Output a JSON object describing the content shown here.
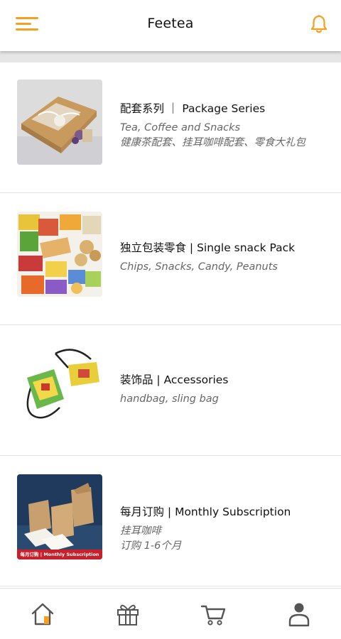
{
  "header": {
    "title": "Feetea",
    "menu_icon": "hamburger-menu-icon",
    "bell_icon": "bell-icon",
    "accent_color": "#f5a020"
  },
  "categories": [
    {
      "title": "配套系列 ｜ Package Series",
      "subtitle_lines": [
        "Tea, Coffee and Snacks",
        "健康茶配套、挂耳咖啡配套、零食大礼包"
      ],
      "image": "gift-package-photo"
    },
    {
      "title": "独立包装零食 | Single snack Pack",
      "subtitle_lines": [
        "Chips, Snacks, Candy, Peanuts"
      ],
      "image": "snack-packs-photo"
    },
    {
      "title": "装饰品 | Accessories",
      "subtitle_lines": [
        "handbag, sling bag"
      ],
      "image": "sling-bag-photo"
    },
    {
      "title": "每月订购 | Monthly Subscription",
      "subtitle_lines": [
        "挂耳咖啡",
        "订购 1-6个月"
      ],
      "image": "subscription-photo",
      "image_banner": "每月订购 | Monthly Subscription"
    }
  ],
  "bottom_nav": [
    {
      "name": "home",
      "icon": "home-icon",
      "active": true
    },
    {
      "name": "gift",
      "icon": "gift-icon",
      "active": false
    },
    {
      "name": "cart",
      "icon": "cart-icon",
      "active": false
    },
    {
      "name": "profile",
      "icon": "user-icon",
      "active": false
    }
  ]
}
